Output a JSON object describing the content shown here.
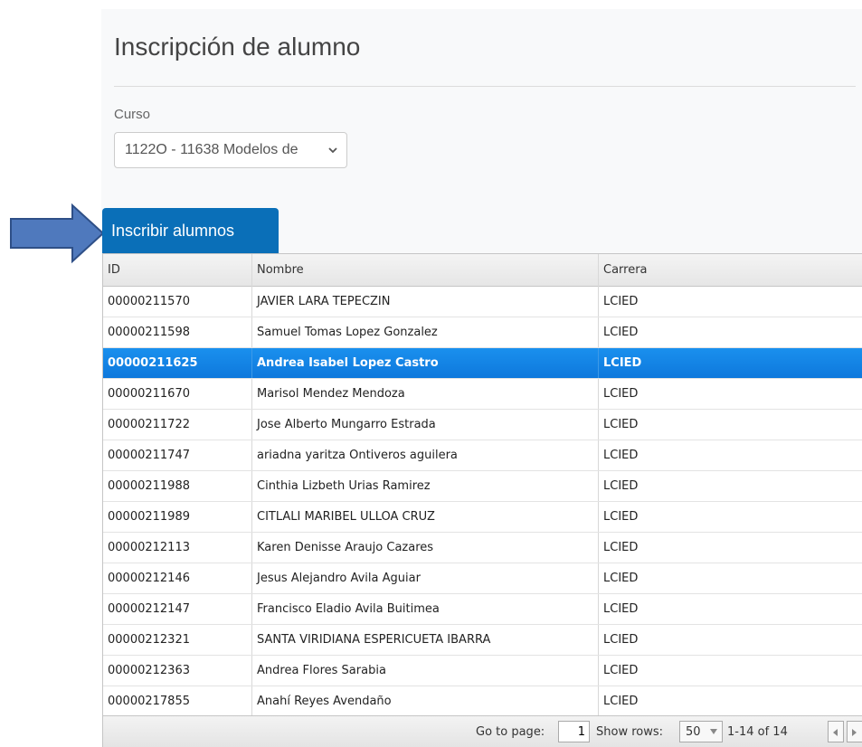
{
  "page": {
    "title": "Inscripción de alumno",
    "course_label": "Curso",
    "course_selected": "1122O - 11638 Modelos de",
    "enroll_button_label": "Inscribir alumnos"
  },
  "colors": {
    "accent_button": "#0a6fb8",
    "selected_row": "#1a90ee",
    "arrow_fill": "#4f79bd",
    "arrow_stroke": "#2e4f87"
  },
  "grid": {
    "columns": [
      "ID",
      "Nombre",
      "Carrera"
    ],
    "selected_index": 2,
    "rows": [
      {
        "id": "00000211570",
        "nombre": "JAVIER LARA TEPECZIN",
        "carrera": "LCIED"
      },
      {
        "id": "00000211598",
        "nombre": "Samuel Tomas Lopez Gonzalez",
        "carrera": "LCIED"
      },
      {
        "id": "00000211625",
        "nombre": "Andrea Isabel Lopez Castro",
        "carrera": "LCIED"
      },
      {
        "id": "00000211670",
        "nombre": "Marisol Mendez Mendoza",
        "carrera": "LCIED"
      },
      {
        "id": "00000211722",
        "nombre": "Jose Alberto Mungarro Estrada",
        "carrera": "LCIED"
      },
      {
        "id": "00000211747",
        "nombre": "ariadna yaritza Ontiveros aguilera",
        "carrera": "LCIED"
      },
      {
        "id": "00000211988",
        "nombre": "Cinthia Lizbeth Urias Ramirez",
        "carrera": "LCIED"
      },
      {
        "id": "00000211989",
        "nombre": "CITLALI MARIBEL ULLOA CRUZ",
        "carrera": "LCIED"
      },
      {
        "id": "00000212113",
        "nombre": "Karen Denisse Araujo Cazares",
        "carrera": "LCIED"
      },
      {
        "id": "00000212146",
        "nombre": "Jesus Alejandro Avila Aguiar",
        "carrera": "LCIED"
      },
      {
        "id": "00000212147",
        "nombre": "Francisco Eladio Avila Buitimea",
        "carrera": "LCIED"
      },
      {
        "id": "00000212321",
        "nombre": "SANTA VIRIDIANA ESPERICUETA IBARRA",
        "carrera": "LCIED"
      },
      {
        "id": "00000212363",
        "nombre": "Andrea Flores Sarabia",
        "carrera": "LCIED"
      },
      {
        "id": "00000217855",
        "nombre": "Anahí Reyes Avendaño",
        "carrera": "LCIED"
      }
    ]
  },
  "pager": {
    "goto_label": "Go to page:",
    "page_value": "1",
    "rows_label": "Show rows:",
    "rows_value": "50",
    "range_text": "1-14 of 14",
    "prev_icon": "chevron-left-icon",
    "next_icon": "chevron-right-icon"
  }
}
